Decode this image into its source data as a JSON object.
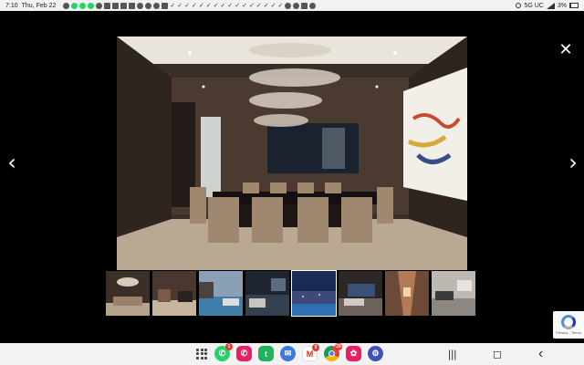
{
  "status_bar": {
    "time": "7:10",
    "date": "Thu, Feb 22",
    "network": "5G UC",
    "battery": "3%"
  },
  "gallery": {
    "close_glyph": "✕",
    "prev_glyph": "‹",
    "next_glyph": "›",
    "thumbnail_count": 8,
    "active_thumbnail": 1
  },
  "recaptcha": {
    "text": "Privacy - Terms"
  },
  "nav_bar": {
    "dock_apps": [
      {
        "icon": "whatsapp-icon",
        "color": "#25d366",
        "badge": "1"
      },
      {
        "icon": "phone-icon",
        "color": "#e91e63",
        "badge": ""
      },
      {
        "icon": "textnow-icon",
        "color": "#1fb35b",
        "badge": ""
      },
      {
        "icon": "messages-icon",
        "color": "#3a7be0",
        "badge": ""
      },
      {
        "icon": "gmail-icon",
        "color": "#ffffff",
        "badge": "9"
      },
      {
        "icon": "chrome-icon",
        "color": "#ffffff",
        "badge": "29"
      },
      {
        "icon": "flower-icon",
        "color": "#e91e63",
        "badge": ""
      },
      {
        "icon": "settings-icon",
        "color": "#3f51b5",
        "badge": ""
      }
    ],
    "recents_glyph": "|||",
    "home_glyph": "◻",
    "back_glyph": "‹"
  }
}
